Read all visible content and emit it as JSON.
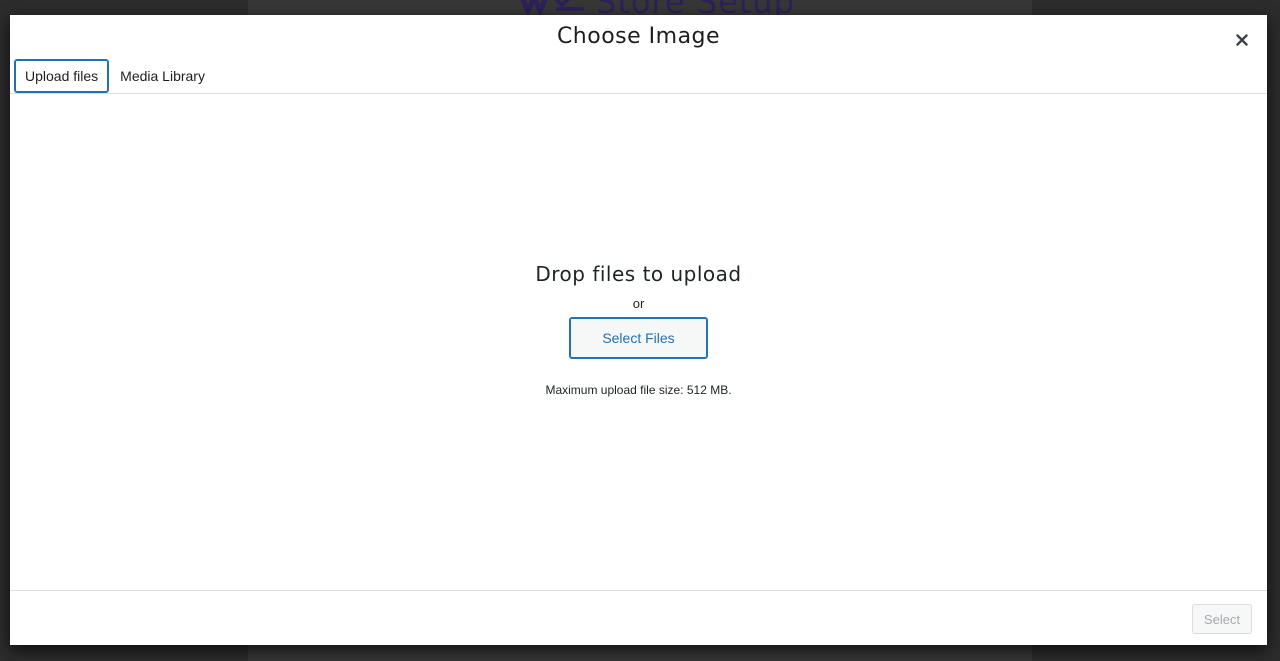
{
  "background": {
    "logo_text": "Store Setup"
  },
  "modal": {
    "title": "Choose Image",
    "close_icon": "close-icon",
    "tabs": [
      {
        "label": "Upload files",
        "active": true
      },
      {
        "label": "Media Library",
        "active": false
      }
    ]
  },
  "upload": {
    "drop_title": "Drop files to upload",
    "or_text": "or",
    "select_files_label": "Select Files",
    "max_size_text": "Maximum upload file size: 512 MB."
  },
  "footer": {
    "select_label": "Select",
    "select_disabled": true
  },
  "colors": {
    "accent": "#2271b1",
    "disabled_text": "#a7aaad",
    "logo": "#3c2d74"
  }
}
